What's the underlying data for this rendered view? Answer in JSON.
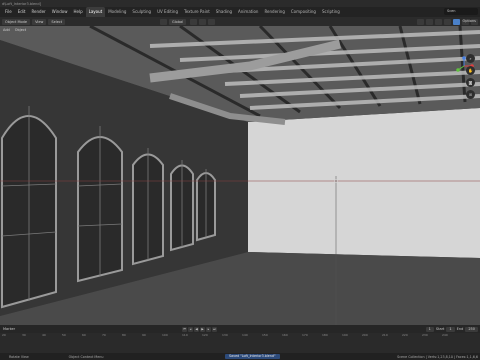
{
  "window": {
    "title": "d\\Loft_Interior3.blend]"
  },
  "menu": {
    "items": [
      "File",
      "Edit",
      "Render",
      "Window",
      "Help"
    ],
    "workspaces": [
      "Layout",
      "Modeling",
      "Sculpting",
      "UV Editing",
      "Texture Paint",
      "Shading",
      "Animation",
      "Rendering",
      "Compositing",
      "Scripting"
    ],
    "active_workspace": "Layout",
    "scene": "Scen"
  },
  "viewport_header": {
    "mode": "Object Mode",
    "view": "View",
    "select": "Select",
    "add": "Add",
    "object": "Object",
    "transform": "Global",
    "options": "Options"
  },
  "toolbar2": {
    "items": [
      "Add",
      "Object"
    ]
  },
  "timeline": {
    "label": "Marker",
    "start_label": "Start",
    "start": "1",
    "end_label": "End",
    "end": "250",
    "current": "1",
    "ruler": [
      "20",
      "30",
      "40",
      "50",
      "60",
      "70",
      "80",
      "90",
      "100",
      "110",
      "120",
      "130",
      "140",
      "150",
      "160",
      "170",
      "180",
      "190",
      "200",
      "210",
      "220",
      "230",
      "240"
    ]
  },
  "status": {
    "left1": "Rotate View",
    "left2": "Object Context Menu",
    "saved": "Saved \"Loft_Interior3.blend\"",
    "stats": "Scene Collection | Verts:1,23,8,10 | Faces:1,1,6,6"
  },
  "colors": {
    "accent": "#4a80c8",
    "wall_left": "#3b3b3b",
    "wall_back": "#d6d6d6",
    "floor": "#4a4a4a"
  }
}
